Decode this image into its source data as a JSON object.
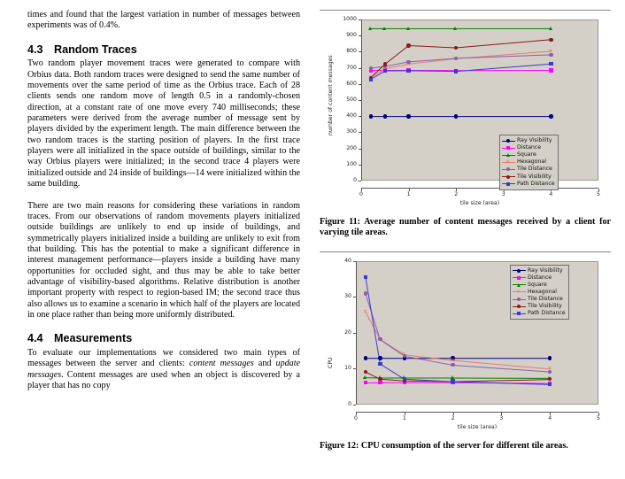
{
  "document": {
    "left_column": {
      "paragraph_continuation": "times and found that the largest variation in number of messages between experiments was of 0.4%.",
      "section_43": {
        "number": "4.3",
        "title": "Random Traces",
        "paragraph_1": "Two random player movement traces were generated to compare with Orbius data. Both random traces were designed to send the same number of movements over the same period of time as the Orbius trace. Each of 28 clients sends one random move of length 0.5 in a randomly-chosen direction, at a constant rate of one move every 740 milliseconds; these parameters were derived from the average number of message sent by players divided by the experiment length. The main difference between the two random traces is the starting position of players. In the first trace players were all initialized in the space outside of buildings, similar to the way Orbius players were initialized; in the second trace 4 players were initialized outside and 24 inside of buildings—14 were initialized within the same building.",
        "paragraph_2": "There are two main reasons for considering these variations in random traces. From our observations of random movements players initialized outside buildings are unlikely to end up inside of buildings, and symmetrically players initialized inside a building are unlikely to exit from that building. This has the potential to make a significant difference in interest management performance—players inside a building have many opportunities for occluded sight, and thus may be able to take better advantage of visibility-based algorithms. Relative distribution is another important property with respect to region-based IM; the second trace thus also allows us to examine a scenario in which half of the players are located in one place rather than being more uniformly distributed."
      },
      "section_44": {
        "number": "4.4",
        "title": "Measurements",
        "paragraph_1_part1": "To evaluate our implementations we considered two main types of messages between the server and clients: ",
        "paragraph_1_italic1": "content messages",
        "paragraph_1_part2": " and ",
        "paragraph_1_italic2": "update messages",
        "paragraph_1_part3": ". Content messages are used when an object is discovered by a player that has no copy"
      }
    },
    "right_column": {
      "figure_11_caption": "Figure 11: Average number of content messages received by a client for varying tile areas.",
      "figure_12_caption": "Figure 12: CPU consumption of the server for different tile areas."
    }
  },
  "colors": {
    "plot_background": "#d4d0c8",
    "plot_border": "#9a9a9a",
    "ray_visibility": "#000080",
    "distance": "#ff00ff",
    "square": "#008000",
    "hexagonal": "#e97b72",
    "tile_distance": "#8b5fa8",
    "tile_visibility": "#8b1a1a",
    "path_distance": "#3a3ad0"
  },
  "chart_data": [
    {
      "id": "figure-11",
      "type": "line",
      "title": "",
      "xlabel": "tile size (area)",
      "ylabel": "number of content messages",
      "xlim": [
        0,
        5
      ],
      "ylim": [
        0,
        1000
      ],
      "xticks": [
        0,
        1,
        2,
        3,
        4,
        5
      ],
      "xticklabels": [
        "0",
        "1",
        "2",
        "3",
        "4",
        "5"
      ],
      "yticks": [
        0,
        100,
        200,
        300,
        400,
        500,
        600,
        700,
        800,
        900,
        1000
      ],
      "yticklabels": [
        "0",
        "100",
        "200",
        "300",
        "400",
        "500",
        "600",
        "700",
        "800",
        "900",
        "1000"
      ],
      "grid": false,
      "legend_position": "lower right",
      "x": [
        0.2,
        0.5,
        1,
        2,
        4
      ],
      "series": [
        {
          "name": "Ray Visibility",
          "color": "#000080",
          "marker": "circle",
          "values": [
            398,
            398,
            398,
            398,
            398
          ]
        },
        {
          "name": "Distance",
          "color": "#ff00ff",
          "marker": "square",
          "values": [
            685,
            684,
            684,
            683,
            684
          ]
        },
        {
          "name": "Square",
          "color": "#008000",
          "marker": "triangle",
          "values": [
            943,
            943,
            943,
            943,
            943
          ]
        },
        {
          "name": "Hexagonal",
          "color": "#e97b72",
          "marker": "cross",
          "values": [
            641,
            694,
            723,
            757,
            803
          ]
        },
        {
          "name": "Tile Distance",
          "color": "#8b5fa8",
          "marker": "circle",
          "values": [
            697,
            709,
            737,
            759,
            781
          ]
        },
        {
          "name": "Tile Visibility",
          "color": "#8b1a1a",
          "marker": "circle",
          "values": [
            639,
            722,
            838,
            824,
            875
          ]
        },
        {
          "name": "Path Distance",
          "color": "#3a3ad0",
          "marker": "square",
          "values": [
            628,
            681,
            682,
            678,
            724
          ]
        }
      ]
    },
    {
      "id": "figure-12",
      "type": "line",
      "title": "",
      "xlabel": "tile size (area)",
      "ylabel": "CPU",
      "xlim": [
        0,
        5
      ],
      "ylim": [
        0,
        40
      ],
      "xticks": [
        0,
        1,
        2,
        3,
        4,
        5
      ],
      "xticklabels": [
        "0",
        "1",
        "2",
        "3",
        "4",
        "5"
      ],
      "yticks": [
        0,
        10,
        20,
        30,
        40
      ],
      "yticklabels": [
        "0",
        "10",
        "20",
        "30",
        "40"
      ],
      "grid": false,
      "legend_position": "upper right",
      "x": [
        0.2,
        0.5,
        1,
        2,
        4
      ],
      "series": [
        {
          "name": "Ray Visibility",
          "color": "#000080",
          "marker": "circle",
          "values": [
            12.9,
            12.9,
            12.9,
            12.9,
            12.9
          ]
        },
        {
          "name": "Distance",
          "color": "#ff00ff",
          "marker": "square",
          "values": [
            6.0,
            6.1,
            6.1,
            6.1,
            5.9
          ]
        },
        {
          "name": "Square",
          "color": "#008000",
          "marker": "triangle",
          "values": [
            7.5,
            7.4,
            7.4,
            7.4,
            7.3
          ]
        },
        {
          "name": "Hexagonal",
          "color": "#e97b72",
          "marker": "cross",
          "values": [
            25.8,
            18.2,
            13.9,
            12.3,
            9.9
          ]
        },
        {
          "name": "Tile Distance",
          "color": "#8b5fa8",
          "marker": "circle",
          "values": [
            30.9,
            18.1,
            13.5,
            11.0,
            9.1
          ]
        },
        {
          "name": "Tile Visibility",
          "color": "#8b1a1a",
          "marker": "circle",
          "values": [
            9.1,
            7.1,
            6.6,
            6.4,
            7.0
          ]
        },
        {
          "name": "Path Distance",
          "color": "#3a3ad0",
          "marker": "square",
          "values": [
            35.5,
            11.3,
            7.1,
            6.4,
            5.6
          ]
        }
      ]
    }
  ]
}
